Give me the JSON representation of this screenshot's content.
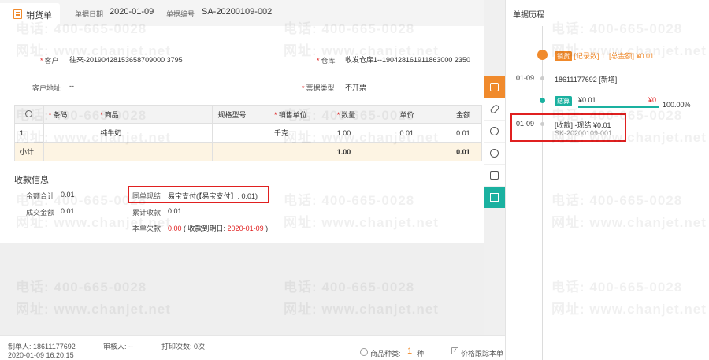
{
  "header": {
    "tab_label": "销货单",
    "date_label": "单据日期",
    "date_value": "2020-01-09",
    "number_label": "单据编号",
    "number_value": "SA-20200109-002"
  },
  "form": {
    "customer_label": "客户",
    "customer_value": "往来-20190428153658709000 3795",
    "warehouse_label": "仓库",
    "warehouse_value": "收发仓库1--190428161911863000 2350",
    "address_label": "客户地址",
    "address_value": "--",
    "invoice_label": "票据类型",
    "invoice_value": "不开票"
  },
  "table": {
    "headers": [
      "条码",
      "商品",
      "规格型号",
      "销售单位",
      "数量",
      "单价",
      "金额"
    ],
    "row": {
      "index": "1",
      "barcode": "",
      "product": "纯牛奶",
      "spec": "",
      "unit": "千克",
      "qty": "1.00",
      "price": "0.01",
      "amount": "0.01"
    },
    "subtotal": {
      "label": "小计",
      "qty": "1.00",
      "amount": "0.01"
    }
  },
  "payment": {
    "title": "收款信息",
    "total_label": "金额合计",
    "total_value": "0.01",
    "settle_label": "同单现结",
    "settle_value": "易宝支付(【易宝支付】: 0.01)",
    "deal_label": "成交金额",
    "deal_value": "0.01",
    "cumulative_label": "累计收款",
    "cumulative_value": "0.01",
    "owed_label": "本单欠款",
    "owed_value": "0.00",
    "due_prefix": "( 收款到期日: ",
    "due_date": "2020-01-09",
    "due_suffix": " )"
  },
  "footer": {
    "maker": "制单人: 18611177692",
    "auditor": "审核人: --",
    "prints": "打印次数: 0次",
    "time": "2020-01-09 16:20:15",
    "kinds_label": "商品种类:",
    "kinds_value": "1",
    "kinds_unit": "种",
    "price_track": "价格跟踪本单"
  },
  "history": {
    "title": "单据历程",
    "sale_badge": "销货",
    "sale_record": "[记录数] 1",
    "sale_total": "[总金额] ¥0.01",
    "date1": "01-09",
    "entry1": "18611177692 [新增]",
    "settle_badge": "结算",
    "settle_amount": "¥0.01",
    "settle_remain": "¥0",
    "settle_percent": "100.00%",
    "date2": "01-09",
    "entry2": "[收款] -现结 ¥0.01",
    "entry2_no": "SK-20200109-001"
  },
  "watermark": {
    "phone": "电话: 400-665-0028",
    "site": "网址: www.chanjet.net"
  },
  "colors": {
    "accent": "#f08a2c",
    "teal": "#1ab1a0",
    "highlight": "#e02020"
  }
}
